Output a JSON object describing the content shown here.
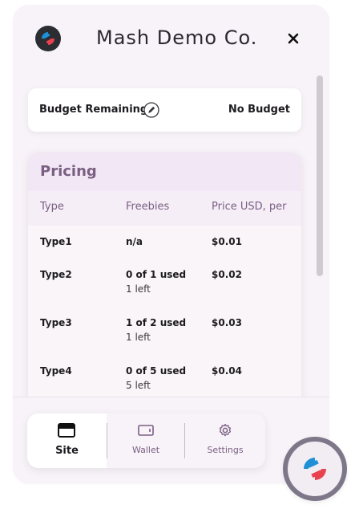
{
  "app": {
    "title": "Mash Demo Co.",
    "close_label": "×"
  },
  "budget": {
    "label": "Budget Remaining",
    "value": "No Budget"
  },
  "pricing": {
    "title": "Pricing",
    "columns": [
      "Type",
      "Freebies",
      "Price USD, per"
    ],
    "rows": [
      {
        "type": "Type1",
        "freebies": "n/a",
        "freebies_sub": "",
        "price": "$0.01"
      },
      {
        "type": "Type2",
        "freebies": "0 of 1 used",
        "freebies_sub": "1 left",
        "price": "$0.02"
      },
      {
        "type": "Type3",
        "freebies": "1 of 2 used",
        "freebies_sub": "1 left",
        "price": "$0.03"
      },
      {
        "type": "Type4",
        "freebies": "0 of 5 used",
        "freebies_sub": "5 left",
        "price": "$0.04"
      }
    ]
  },
  "tabs": [
    {
      "label": "Site",
      "icon": "site-icon",
      "active": true
    },
    {
      "label": "Wallet",
      "icon": "wallet-icon",
      "active": false
    },
    {
      "label": "Settings",
      "icon": "gear-icon",
      "active": false
    }
  ],
  "colors": {
    "accent": "#7a5f83",
    "panel_bg": "#f7f3f8",
    "logo_red": "#e8424f",
    "logo_blue": "#1f8fd6"
  }
}
